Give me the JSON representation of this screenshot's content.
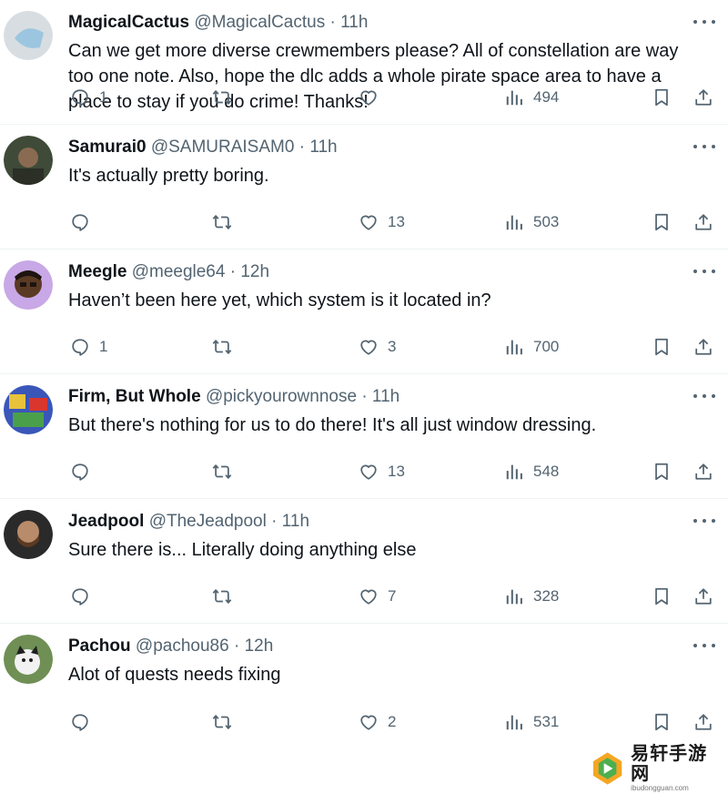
{
  "tweets": [
    {
      "name": "MagicalCactus",
      "handle": "@MagicalCactus",
      "time": "11h",
      "text": "Can we get more diverse crewmembers please? All of constellation are way too one note. Also, hope the dlc adds a whole pirate space area to have a place to stay if you do crime! Thanks!",
      "replies": "1",
      "retweets": "",
      "likes": "",
      "views": "494",
      "avatar_color": "#b9c6cf"
    },
    {
      "name": "Samurai0",
      "handle": "@SAMURAISAM0",
      "time": "11h",
      "text": "It's actually pretty boring.",
      "replies": "",
      "retweets": "",
      "likes": "13",
      "views": "503",
      "avatar_color": "#3f4a38"
    },
    {
      "name": "Meegle",
      "handle": "@meegle64",
      "time": "12h",
      "text": "Haven’t been here yet, which system is it located in?",
      "replies": "1",
      "retweets": "",
      "likes": "3",
      "views": "700",
      "avatar_color": "#c8a8e6"
    },
    {
      "name": "Firm, But Whole",
      "handle": "@pickyourownnose",
      "time": "11h",
      "text": "But there's nothing for us to do there! It's all just window dressing.",
      "replies": "",
      "retweets": "",
      "likes": "13",
      "views": "548",
      "avatar_color": "#3a56b8"
    },
    {
      "name": "Jeadpool",
      "handle": "@TheJeadpool",
      "time": "11h",
      "text": "Sure there is... Literally doing anything else",
      "replies": "",
      "retweets": "",
      "likes": "7",
      "views": "328",
      "avatar_color": "#2a2a2a"
    },
    {
      "name": "Pachou",
      "handle": "@pachou86",
      "time": "12h",
      "text": "Alot of quests needs fixing",
      "replies": "",
      "retweets": "",
      "likes": "2",
      "views": "531",
      "avatar_color": "#6f8f55"
    }
  ],
  "dot": "·",
  "watermark": {
    "title": "易轩手游网",
    "subtitle": "ibudongguan.com"
  },
  "colors": {
    "text": "#0f1419",
    "muted": "#536471",
    "divider": "#eff3f4"
  }
}
